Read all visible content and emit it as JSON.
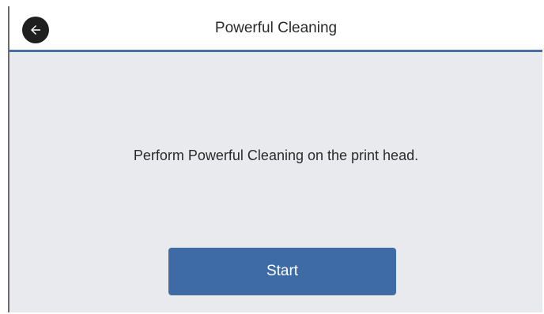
{
  "header": {
    "title": "Powerful Cleaning",
    "back_icon": "back-arrow-icon"
  },
  "main": {
    "message": "Perform Powerful Cleaning on the print head.",
    "start_label": "Start"
  },
  "colors": {
    "accent": "#4a6ea8",
    "button": "#3e6aa6",
    "background": "#e9eaee",
    "header_bg": "#ffffff"
  }
}
